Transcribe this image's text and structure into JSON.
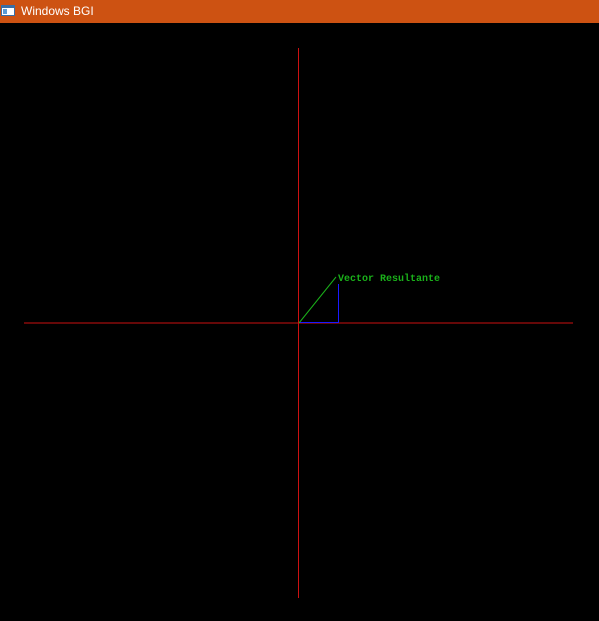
{
  "window": {
    "title": "Windows BGI",
    "icon": "application-window-icon",
    "titlebar_color": "#cd5212"
  },
  "canvas": {
    "background_color": "#000000",
    "axes_color": "#cc1111",
    "component_color": "#1a1aff",
    "resultant_color": "#1ab01a",
    "resultant_label": "Vector Resultante"
  }
}
